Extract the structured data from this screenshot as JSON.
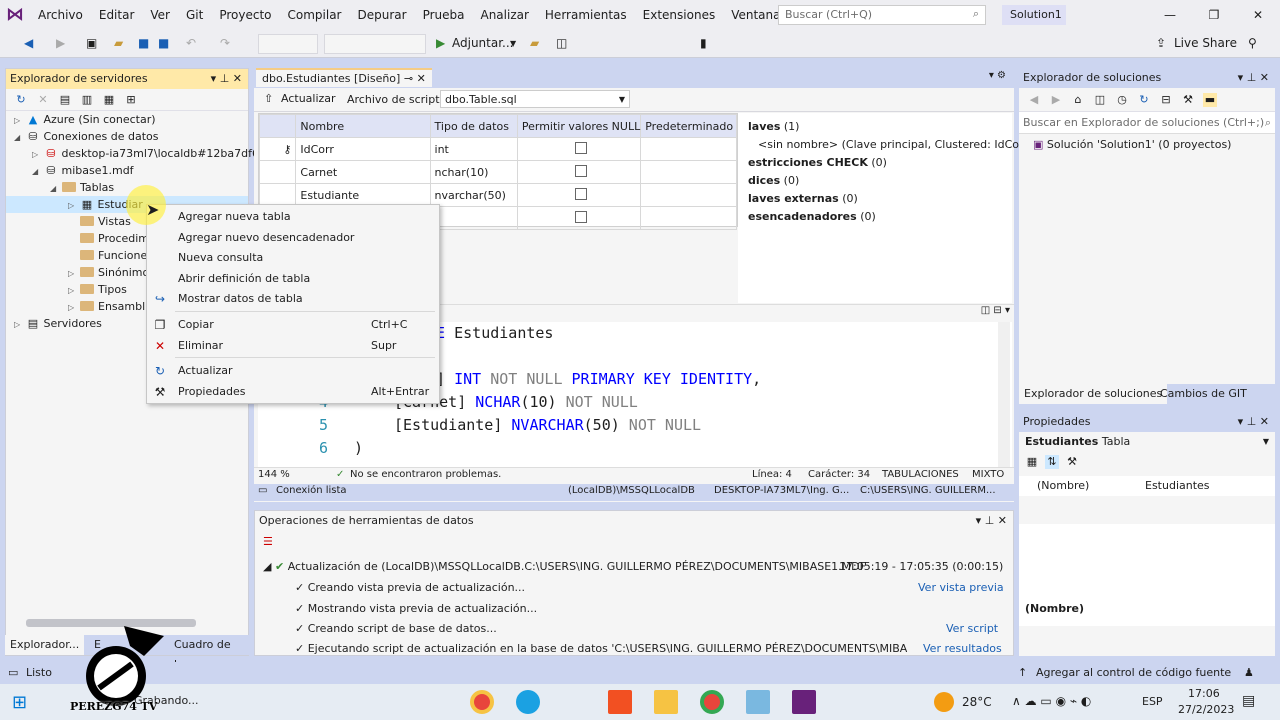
{
  "colors": {
    "accent": "#68217a",
    "chrome": "#ccd5f0",
    "highlight": "#ffe9a8",
    "link": "#1a5fb4",
    "keyword": "#0000ff",
    "comment_gray": "#808080"
  },
  "menubar": {
    "logo": "visual-studio-icon",
    "items": [
      "Archivo",
      "Editar",
      "Ver",
      "Git",
      "Proyecto",
      "Compilar",
      "Depurar",
      "Prueba",
      "Analizar",
      "Herramientas",
      "Extensiones",
      "Ventana",
      "Ayuda"
    ],
    "search_placeholder": "Buscar (Ctrl+Q)",
    "solution": "Solution1"
  },
  "toolbar": {
    "run_label": "Adjuntar...",
    "live_share": "Live Share"
  },
  "server_explorer": {
    "title": "Explorador de servidores",
    "nodes": [
      {
        "label": "Azure (Sin conectar)"
      },
      {
        "label": "Conexiones de datos"
      },
      {
        "label": "desktop-ia73ml7\\localdb#12ba7df6"
      },
      {
        "label": "mibase1.mdf"
      },
      {
        "label": "Tablas"
      },
      {
        "label": "Estudiar"
      },
      {
        "label": "Vistas"
      },
      {
        "label": "Procedimie"
      },
      {
        "label": "Funciones"
      },
      {
        "label": "Sinónimos"
      },
      {
        "label": "Tipos"
      },
      {
        "label": "Ensambl"
      },
      {
        "label": "Servidores"
      }
    ],
    "tabs": [
      "Explorador...",
      "E",
      "Cuadro de h..."
    ]
  },
  "designer": {
    "tab": "dbo.Estudiantes [Diseño]",
    "update_label": "Actualizar",
    "script_label": "Archivo de script:",
    "script_file": "dbo.Table.sql",
    "columns_header": [
      "Nombre",
      "Tipo de datos",
      "Permitir valores NULL",
      "Predeterminado"
    ],
    "rows": [
      {
        "name": "IdCorr",
        "type": "int",
        "pk": true
      },
      {
        "name": "Carnet",
        "type": "nchar(10)"
      },
      {
        "name": "Estudiante",
        "type": "nvarchar(50)"
      },
      {
        "name": "",
        "type": ""
      }
    ],
    "info": [
      {
        "bold": "laves",
        "rest": " (1)"
      },
      {
        "bold": "",
        "rest": "<sin nombre>   (Clave principal, Clustered: IdCorr)"
      },
      {
        "bold": "estricciones CHECK",
        "rest": " (0)"
      },
      {
        "bold": "dices",
        "rest": " (0)"
      },
      {
        "bold": "laves externas",
        "rest": " (0)"
      },
      {
        "bold": "esencadenadores",
        "rest": " (0)"
      }
    ],
    "sql": {
      "line_numbers": [
        "4",
        "5",
        "6"
      ],
      "l1_kw": "BLE",
      "l1_rest": " Estudiantes",
      "l3_pre": "rr] ",
      "l3_kw1": "INT",
      "l3_gr": " NOT NULL",
      "l3_kw2": " PRIMARY KEY IDENTITY",
      ",": ",",
      "l4_pre": "[Carnet] ",
      "l4_kw": "NCHAR",
      "l4_mid": "(10)",
      "l4_gr": " NOT NULL",
      "l5_pre": "[Estudiante] ",
      "l5_kw": "NVARCHAR",
      "l5_mid": "(50)",
      "l5_gr": " NOT NULL",
      "l6": ")"
    },
    "status": {
      "zoom": "144 %",
      "problems": "No se encontraron problemas.",
      "line": "Línea: 4",
      "char": "Carácter: 34",
      "tabs": "TABULACIONES",
      "mixed": "MIXTO"
    },
    "conn": {
      "state": "Conexión lista",
      "db": "(LocalDB)\\MSSQLLocalDB",
      "user": "DESKTOP-IA73ML7\\Ing. G...",
      "path": "C:\\USERS\\ING. GUILLERM..."
    }
  },
  "context_menu": {
    "items": [
      {
        "label": "Agregar nueva tabla",
        "shortcut": "",
        "icon": ""
      },
      {
        "label": "Agregar nuevo desencadenador",
        "shortcut": "",
        "icon": ""
      },
      {
        "label": "Nueva consulta",
        "shortcut": "",
        "icon": ""
      },
      {
        "label": "Abrir definición de tabla",
        "shortcut": "",
        "icon": ""
      },
      {
        "label": "Mostrar datos de tabla",
        "shortcut": "",
        "icon": "arrow-icon"
      },
      {
        "label": "Copiar",
        "shortcut": "Ctrl+C",
        "icon": "copy-icon"
      },
      {
        "label": "Eliminar",
        "shortcut": "Supr",
        "icon": "delete-icon"
      },
      {
        "label": "Actualizar",
        "shortcut": "",
        "icon": "refresh-icon"
      },
      {
        "label": "Propiedades",
        "shortcut": "Alt+Entrar",
        "icon": "wrench-icon"
      }
    ]
  },
  "data_tools": {
    "title": "Operaciones de herramientas de datos",
    "main": "Actualización de (LocalDB)\\MSSQLLocalDB.C:\\USERS\\ING. GUILLERMO PÉREZ\\DOCUMENTS\\MIBASE1.MDF",
    "time": "17:05:19 - 17:05:35 (0:00:15)",
    "steps": [
      {
        "text": "Creando vista previa de actualización...",
        "link": "Ver vista previa"
      },
      {
        "text": "Mostrando vista previa de actualización...",
        "link": ""
      },
      {
        "text": "Creando script de base de datos...",
        "link": "Ver script"
      },
      {
        "text": "Ejecutando script de actualización en la base de datos 'C:\\USERS\\ING. GUILLERMO PÉREZ\\DOCUMENTS\\MIBASE1.MDF'...",
        "link": "Ver resultados"
      }
    ]
  },
  "solution_explorer": {
    "title": "Explorador de soluciones",
    "search": "Buscar en Explorador de soluciones (Ctrl+;)",
    "item": "Solución 'Solution1'  (0 proyectos)",
    "tab1": "Explorador de soluciones",
    "tab2": "Cambios de GIT"
  },
  "properties": {
    "title": "Propiedades",
    "object": "Estudiantes",
    "type": "Tabla",
    "prop_name": "(Nombre)",
    "prop_value": "Estudiantes",
    "desc": "(Nombre)"
  },
  "statusbar": {
    "ready": "Listo",
    "source_control": "Agregar al control de código fuente"
  },
  "taskbar": {
    "recording": "Grabando...",
    "temp": "28°C",
    "lang": "ESP",
    "time": "17:06",
    "date": "27/2/2023"
  },
  "watermark": {
    "text": "PEREZG74 TV"
  }
}
